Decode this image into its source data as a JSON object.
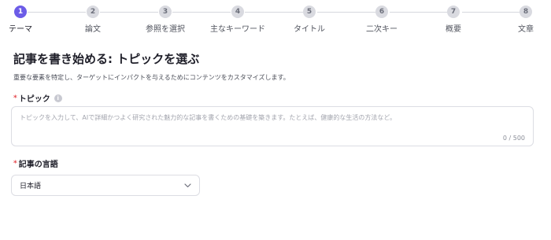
{
  "stepper": {
    "steps": [
      {
        "number": "1",
        "label": "テーマ"
      },
      {
        "number": "2",
        "label": "論文"
      },
      {
        "number": "3",
        "label": "参照を選択"
      },
      {
        "number": "4",
        "label": "主なキーワード"
      },
      {
        "number": "5",
        "label": "タイトル"
      },
      {
        "number": "6",
        "label": "二次キー"
      },
      {
        "number": "7",
        "label": "概要"
      },
      {
        "number": "8",
        "label": "文章"
      }
    ],
    "active_index": 0,
    "colors": {
      "active": "#6c5ce7",
      "inactive": "#d9dae0"
    }
  },
  "header": {
    "title": "記事を書き始める: トピックを選ぶ",
    "subtitle": "重要な要素を特定し、ターゲットにインパクトを与えるためにコンテンツをカスタマイズします。"
  },
  "topic": {
    "required_mark": "*",
    "label": "トピック",
    "info_icon": "info-icon",
    "placeholder": "トピックを入力して、AIで詳細かつよく研究された魅力的な記事を書くための基礎を築きます。たとえば、健康的な生活の方法など。",
    "value": "",
    "counter": "0 / 500"
  },
  "language": {
    "required_mark": "*",
    "label": "記事の言語",
    "selected": "日本語",
    "icon": "chevron-down-icon"
  }
}
